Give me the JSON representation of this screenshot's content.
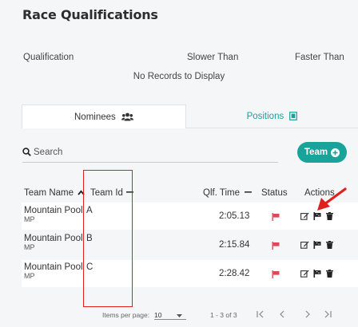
{
  "page": {
    "title": "Race Qualifications"
  },
  "qualifications": {
    "columns": [
      "Qualification",
      "Slower Than",
      "Faster Than"
    ],
    "empty_text": "No Records to Display"
  },
  "tabs": [
    {
      "label": "Nominees",
      "icon": "users-icon"
    },
    {
      "label": "Positions",
      "icon": "badge-icon"
    }
  ],
  "colors": {
    "accent": "#1aa39a",
    "status": "#e0475b",
    "annotation": "#e0201c"
  },
  "search": {
    "placeholder": "Search",
    "value": ""
  },
  "team_button": {
    "label": "Team"
  },
  "table": {
    "headers": {
      "team_name": "Team Name",
      "team_id": "Team Id",
      "qlf_time": "Qlf. Time",
      "status": "Status",
      "actions": "Actions"
    },
    "rows": [
      {
        "name": "Mountain Pool",
        "short": "MP",
        "team_id": "A",
        "qlf_time": "2:05.13"
      },
      {
        "name": "Mountain Pool",
        "short": "MP",
        "team_id": "B",
        "qlf_time": "2:15.84"
      },
      {
        "name": "Mountain Pool",
        "short": "MP",
        "team_id": "C",
        "qlf_time": "2:28.42"
      }
    ]
  },
  "pagination": {
    "items_per_page_label": "Items per page:",
    "items_per_page": "10",
    "range": "1 - 3 of 3"
  }
}
